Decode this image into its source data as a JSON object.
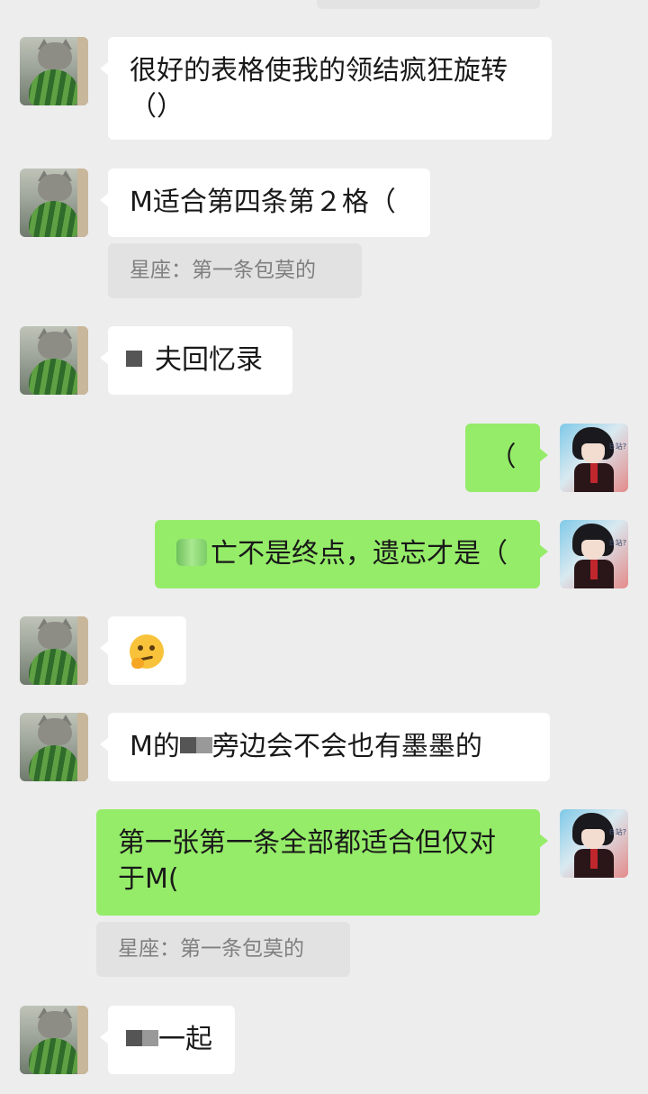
{
  "messages": [
    {
      "sender": "other",
      "avatar": "cat-avatar",
      "text": "很好的表格使我的领结疯狂旋转\n（）"
    },
    {
      "sender": "other",
      "avatar": "cat-avatar",
      "text": "M适合第四条第２格（",
      "quote": "星座：第一条包莫的"
    },
    {
      "sender": "other",
      "avatar": "cat-avatar",
      "text": "夫回忆录"
    },
    {
      "sender": "self",
      "avatar": "boy-avatar",
      "text": "（"
    },
    {
      "sender": "self",
      "avatar": "boy-avatar",
      "text": "亡不是终点，遗忘才是（"
    },
    {
      "sender": "other",
      "avatar": "cat-avatar",
      "emoji": "thinking-face-emoji"
    },
    {
      "sender": "other",
      "avatar": "cat-avatar",
      "text_a": "M的",
      "text_b": "旁边会不会也有墨墨的"
    },
    {
      "sender": "self",
      "avatar": "boy-avatar",
      "text": "第一张第一条全部都适合但仅对\n于M(",
      "quote": "星座：第一条包莫的"
    },
    {
      "sender": "other",
      "avatar": "cat-avatar",
      "text": "一起"
    }
  ],
  "avatar_tag": "Ｂ站?"
}
